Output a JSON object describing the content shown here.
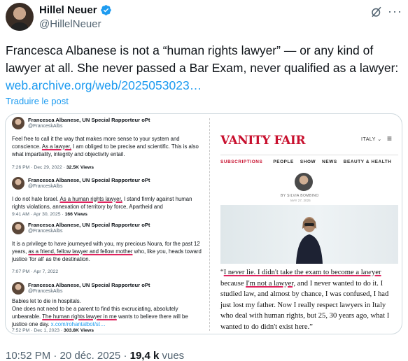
{
  "author": {
    "display_name": "Hillel Neuer",
    "handle": "@HillelNeuer",
    "avatar_icon": "user-avatar",
    "verified_icon": "verified-badge-icon"
  },
  "tweet": {
    "text": "Francesca Albanese is not a “human rights lawyer” — or any kind of lawyer at all. She never passed a Bar Exam, never qualified as a lawyer:",
    "link": "web.archive.org/web/2025053023…",
    "translate_label": "Traduire le post"
  },
  "media": {
    "tweets": [
      {
        "name": "Francesca Albanese, UN Special Rapporteur oPt",
        "handle": "@FranceskAlbs",
        "before": "Feel free to call it the way that makes more sense to your system and conscience. ",
        "underlined": "As a lawyer,",
        "after": " I am obliged to be precise and scientific. This is also what impartiality, integrity and objectivity entail.",
        "time": "7:26 PM · Dec 29, 2022 · ",
        "views": "32.5K Views"
      },
      {
        "name": "Francesca Albanese, UN Special Rapporteur oPt",
        "handle": "@FranceskAlbs",
        "before": "I do not hate Israel. ",
        "underlined": "As a human rights lawyer,",
        "after": " I stand firmly against human rights violations, annexation of territory by force, Apartheid and",
        "time": "9:41 AM · Apr 30, 2025 · ",
        "views": "166 Views"
      },
      {
        "name": "Francesca Albanese, UN Special Rapporteur oPt",
        "handle": "@FranceskAlbs",
        "before": "It is a privilege to have journeyed with you, my precious Noura, for the past 12 years, ",
        "underlined": "as a friend, fellow lawyer and fellow mother",
        "after": " who, like you, heads toward justice 'for all' as the destination.",
        "time": "7:07 PM · Apr 7, 2022",
        "views": ""
      },
      {
        "name": "Francesca Albanese, UN Special Rapporteur oPt",
        "handle": "@FranceskAlbs",
        "before": "Babies let to die in hospitals.\nOne does not need to be a parent to find this excruciating, absolutely unbearable. ",
        "underlined": "The human rights lawyer in me",
        "after": " wants to believe there will be justice one day. ",
        "link": "x.com/rohantalbot/st…",
        "time": "7:52 PM · Dec 1, 2023 · ",
        "views": "303.8K Views"
      }
    ],
    "vanity_fair": {
      "logo": "VANITY FAIR",
      "edition": "ITALY ⌄",
      "nav": [
        "SUBSCRIPTIONS",
        "PEOPLE",
        "SHOW",
        "NEWS",
        "BEAUTY & HEALTH"
      ],
      "byline": "BY SILVIA BOMBINO",
      "date": "MAY 27, 2025",
      "quote_start": "“",
      "quote_u1": "I never lie. I didn't take the exam to become a lawyer",
      "quote_mid": " because ",
      "quote_u2": "I'm not a lawyer,",
      "quote_end": " and I never wanted to do it. I studied law, and almost by chance, I was confused, I had just lost my father. Now I really respect lawyers in Italy who deal with human rights, but 25, 30 years ago, what I wanted to do didn't exist here.”"
    }
  },
  "footer": {
    "time": "10:52 PM · 20 déc. 2025 · ",
    "views_count": "19,4 k",
    "views_label": " vues"
  },
  "colors": {
    "link": "#1d9bf0",
    "underline": "#e0245e",
    "vf_red": "#c8102e"
  }
}
